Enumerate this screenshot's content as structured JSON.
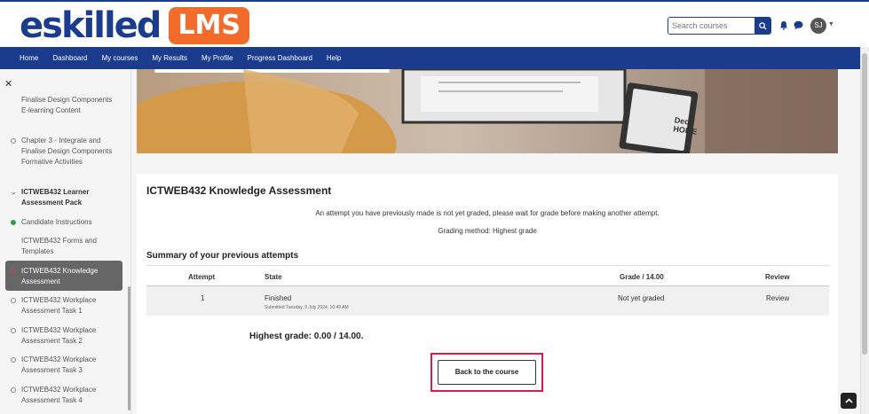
{
  "brand": {
    "name": "eskilled",
    "badge": "LMS"
  },
  "search": {
    "placeholder": "Search courses"
  },
  "user": {
    "initials": "SJ"
  },
  "nav": {
    "items": [
      "Home",
      "Dashboard",
      "My courses",
      "My Results",
      "My Profile",
      "Progress Dashboard",
      "Help"
    ]
  },
  "sidebar": {
    "items": [
      {
        "label": "Finalise Design Components E-learning Content",
        "type": "activity",
        "status": "none"
      },
      {
        "label": "Chapter 3 - Integrate and Finalise Design Components Formative Activities",
        "type": "activity",
        "status": "incomplete"
      },
      {
        "label": "ICTWEB432 Learner Assessment Pack",
        "type": "section"
      },
      {
        "label": "Candidate Instructions",
        "type": "activity",
        "status": "complete"
      },
      {
        "label": "ICTWEB432 Forms and Templates",
        "type": "activity",
        "status": "none"
      },
      {
        "label": "ICTWEB432 Knowledge Assessment",
        "type": "activity",
        "status": "active"
      },
      {
        "label": "ICTWEB432 Workplace Assessment Task 1",
        "type": "activity",
        "status": "incomplete"
      },
      {
        "label": "ICTWEB432 Workplace Assessment Task 2",
        "type": "activity",
        "status": "incomplete"
      },
      {
        "label": "ICTWEB432 Workplace Assessment Task 3",
        "type": "activity",
        "status": "incomplete"
      },
      {
        "label": "ICTWEB432 Workplace Assessment Task 4",
        "type": "activity",
        "status": "incomplete"
      }
    ]
  },
  "hero": {
    "laptop_text": "Deco HOME"
  },
  "quiz": {
    "title": "ICTWEB432 Knowledge Assessment",
    "notice": "An attempt you have previously made is not yet graded, please wait for grade before making another attempt.",
    "grading_method": "Grading method: Highest grade",
    "summary_title": "Summary of your previous attempts",
    "columns": [
      "Attempt",
      "State",
      "Grade / 14.00",
      "Review"
    ],
    "rows": [
      {
        "attempt": "1",
        "state": "Finished",
        "submitted": "Submitted Tuesday, 9 July 2024, 10:49 AM",
        "grade": "Not yet graded",
        "review": "Review"
      }
    ],
    "highest_grade": "Highest grade: 0.00 / 14.00.",
    "back_button": "Back to the course"
  },
  "colors": {
    "brand_blue": "#1b3c8c",
    "lms_orange": "#f26b2a",
    "highlight_red": "#d81b4a",
    "complete_green": "#2e9e46"
  }
}
